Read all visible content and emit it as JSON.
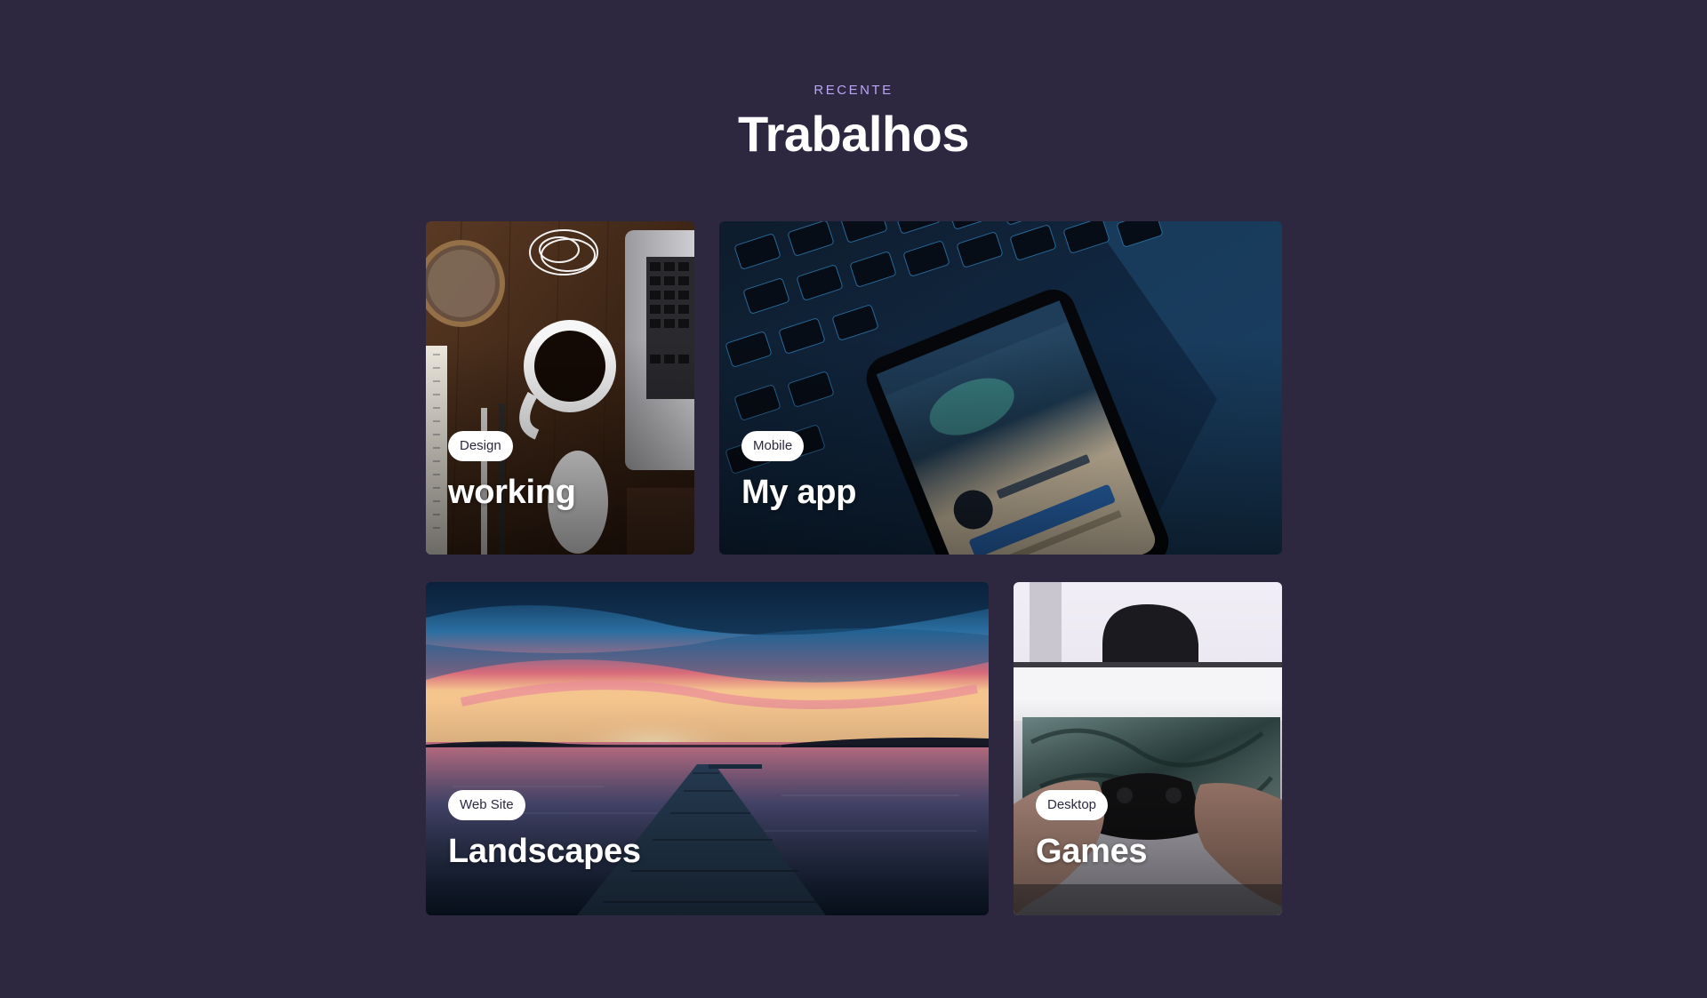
{
  "section": {
    "eyebrow": "RECENTE",
    "title": "Trabalhos"
  },
  "projects": [
    {
      "tag": "Design",
      "title": "working",
      "image": "desk-flatlay-laptop-coffee"
    },
    {
      "tag": "Mobile",
      "title": "My app",
      "image": "phone-on-keyboard"
    },
    {
      "tag": "Web Site",
      "title": "Landscapes",
      "image": "lake-pier-sunset"
    },
    {
      "tag": "Desktop",
      "title": "Games",
      "image": "hands-holding-gamepad"
    }
  ],
  "colors": {
    "background": "#2d2840",
    "accent": "#b9a6f5",
    "tag_background": "#ffffff",
    "tag_text": "#2d2840",
    "title_text": "#ffffff"
  }
}
